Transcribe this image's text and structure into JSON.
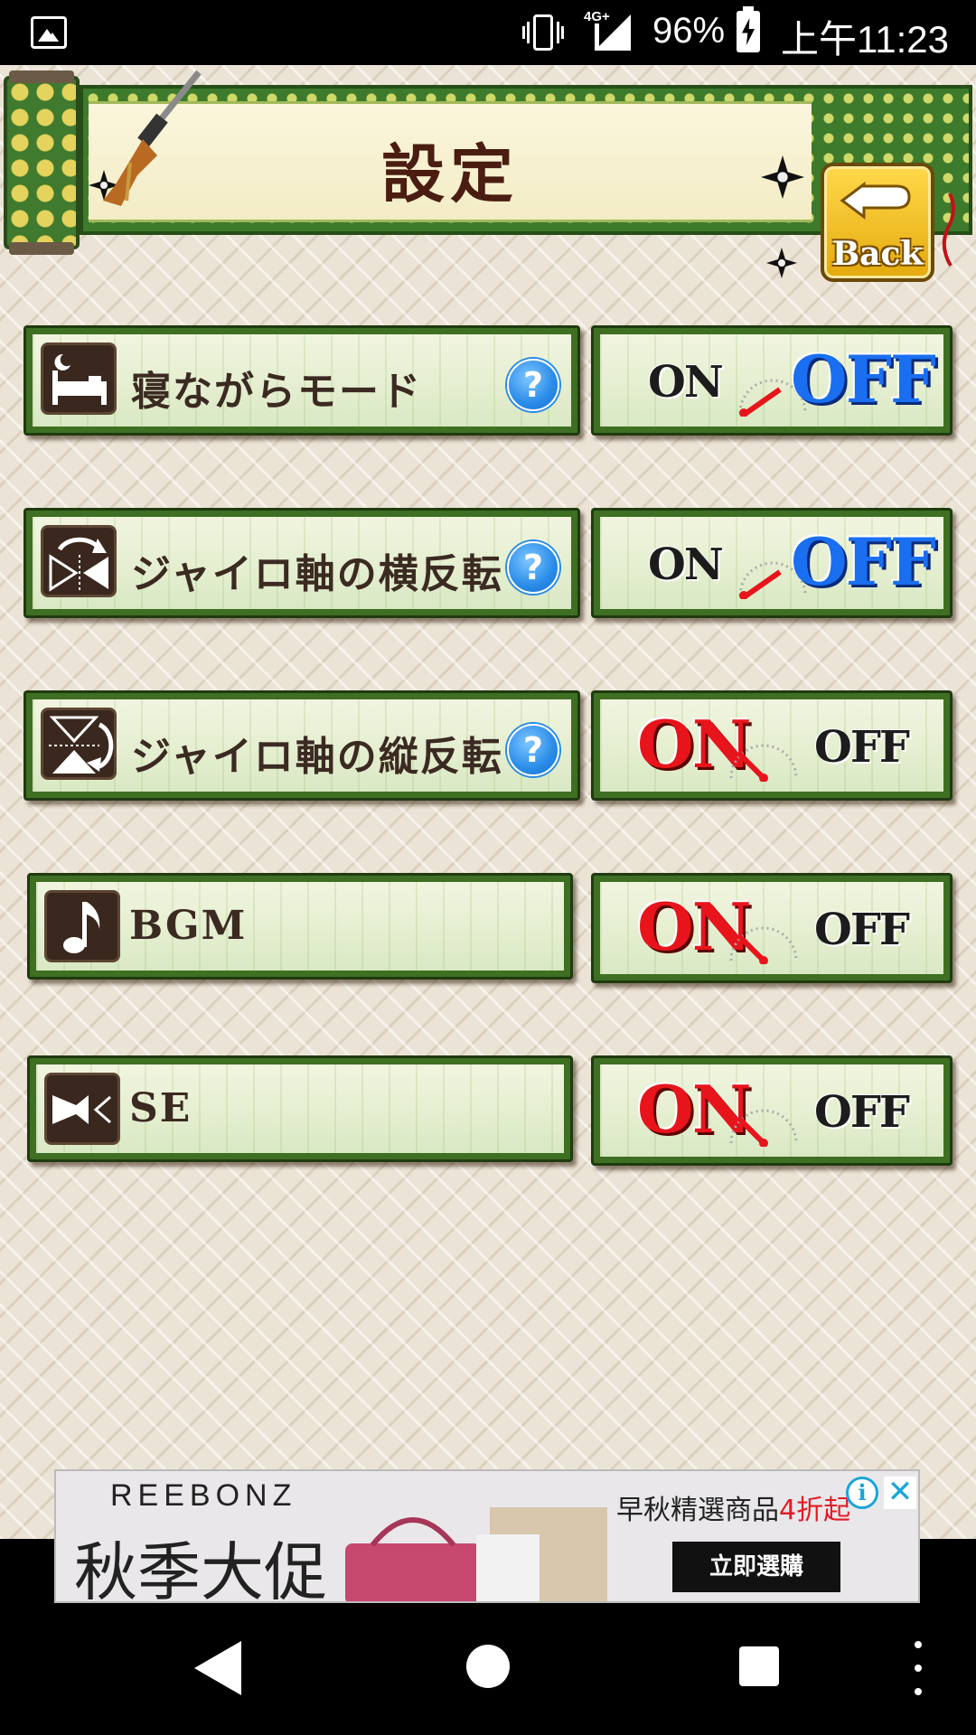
{
  "status_bar": {
    "network": "4G+",
    "battery_percent": "96%",
    "time": "上午11:23",
    "icons": [
      "gallery-icon",
      "vibrate-icon",
      "signal-icon",
      "battery-charging-icon"
    ]
  },
  "header": {
    "title": "設定",
    "back_label": "Back"
  },
  "settings": [
    {
      "label": "寝ながらモード",
      "icon": "sleep-bed-icon",
      "has_help": true,
      "help_text": "?",
      "on_label": "ON",
      "off_label": "OFF",
      "state": "OFF"
    },
    {
      "label": "ジャイロ軸の横反転",
      "icon": "gyro-horizontal-flip-icon",
      "has_help": true,
      "help_text": "?",
      "on_label": "ON",
      "off_label": "OFF",
      "state": "OFF"
    },
    {
      "label": "ジャイロ軸の縦反転",
      "icon": "gyro-vertical-flip-icon",
      "has_help": true,
      "help_text": "?",
      "on_label": "ON",
      "off_label": "OFF",
      "state": "ON"
    },
    {
      "label": "BGM",
      "icon": "music-note-icon",
      "has_help": false,
      "on_label": "ON",
      "off_label": "OFF",
      "state": "ON"
    },
    {
      "label": "SE",
      "icon": "speaker-icon",
      "has_help": false,
      "on_label": "ON",
      "off_label": "OFF",
      "state": "ON"
    }
  ],
  "ad": {
    "brand": "REEBONZ",
    "headline": "秋季大促",
    "sub_text": "早秋精選商品",
    "sub_highlight": "4折起",
    "cta": "立即選購",
    "info_label": "i",
    "close_label": "✕"
  },
  "colors": {
    "frame_green": "#3e6f22",
    "on_red": "#e8141c",
    "off_blue": "#1a6ff0",
    "title_brown": "#4a1c12",
    "back_gold": "#ffd94b"
  }
}
